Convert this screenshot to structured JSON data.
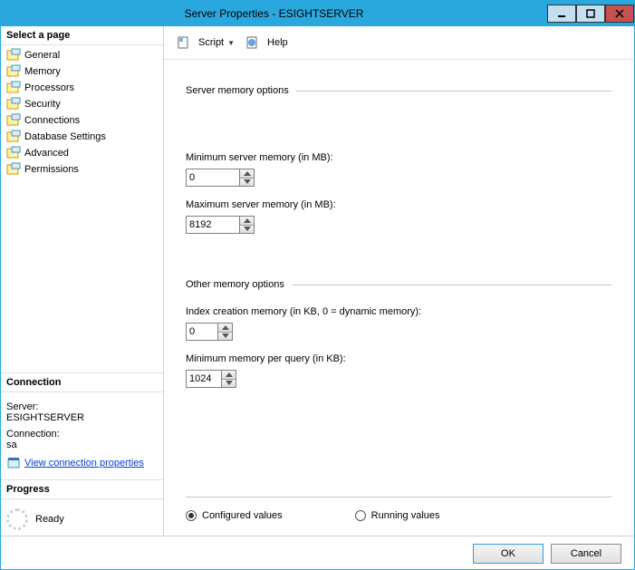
{
  "title": "Server Properties - ESIGHTSERVER",
  "left": {
    "select_page": "Select a page",
    "pages": [
      "General",
      "Memory",
      "Processors",
      "Security",
      "Connections",
      "Database Settings",
      "Advanced",
      "Permissions"
    ],
    "connection_header": "Connection",
    "server_label": "Server:",
    "server_value": "ESIGHTSERVER",
    "connection_label": "Connection:",
    "connection_value": "sa",
    "view_props": "View connection properties",
    "progress_header": "Progress",
    "ready": "Ready"
  },
  "toolbar": {
    "script": "Script",
    "help": "Help"
  },
  "main": {
    "section1": "Server memory options",
    "min_mem_label": "Minimum server memory (in MB):",
    "min_mem_value": "0",
    "max_mem_label": "Maximum server memory (in MB):",
    "max_mem_value": "8192",
    "section2": "Other memory options",
    "index_label": "Index creation memory (in KB, 0 = dynamic memory):",
    "index_value": "0",
    "min_query_label": "Minimum memory per query (in KB):",
    "min_query_value": "1024",
    "configured": "Configured values",
    "running": "Running values"
  },
  "footer": {
    "ok": "OK",
    "cancel": "Cancel"
  }
}
